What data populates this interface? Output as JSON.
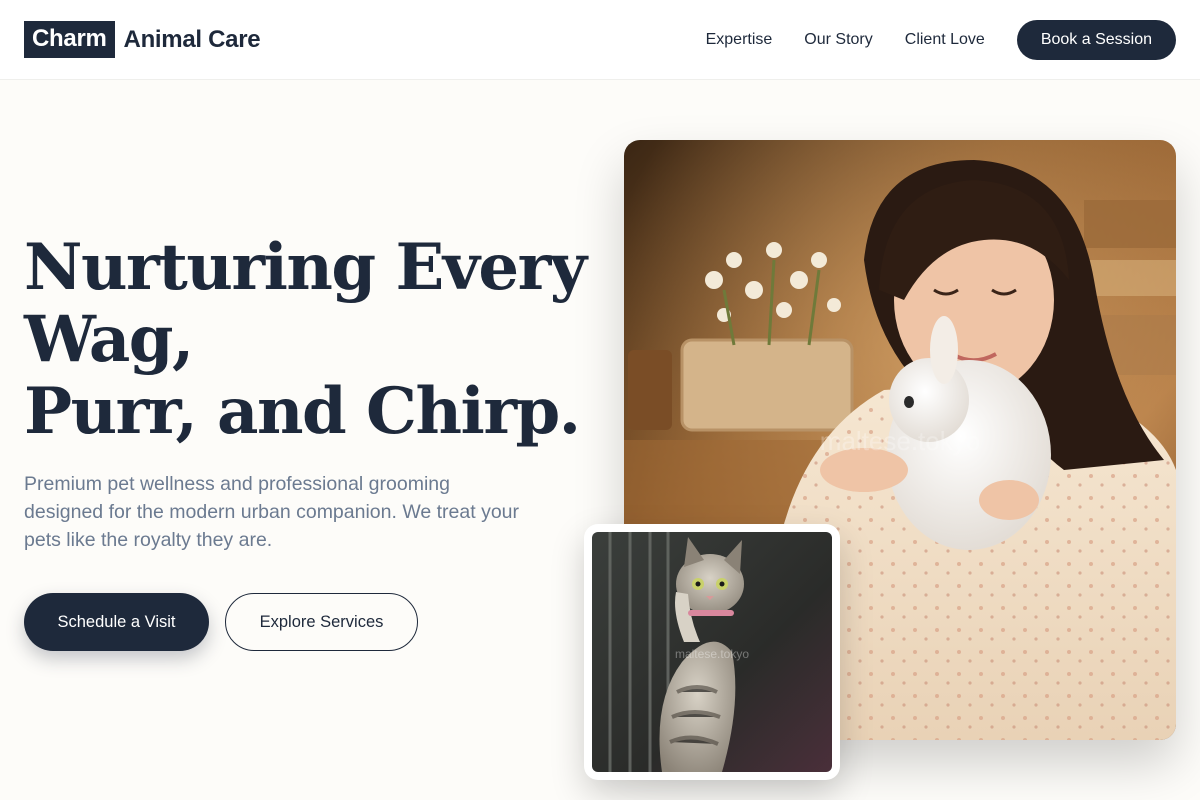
{
  "brand": {
    "mark": "Charm",
    "name": "Animal Care"
  },
  "nav": {
    "links": [
      "Expertise",
      "Our Story",
      "Client Love"
    ],
    "cta": "Book a Session"
  },
  "hero": {
    "title_lines": [
      "Nurturing Every Wag,",
      "Purr, and Chirp."
    ],
    "subtitle": "Premium pet wellness and professional grooming designed for the modern urban companion. We treat your pets like the royalty they are.",
    "primary_button": "Schedule a Visit",
    "secondary_button": "Explore Services"
  },
  "images": {
    "main_watermark": "maltese.tokyo",
    "secondary_watermark": "maltese.tokyo"
  },
  "colors": {
    "brand_navy": "#1e293b",
    "muted_text": "#6b7a90",
    "page_background": "#fdfcf9"
  }
}
